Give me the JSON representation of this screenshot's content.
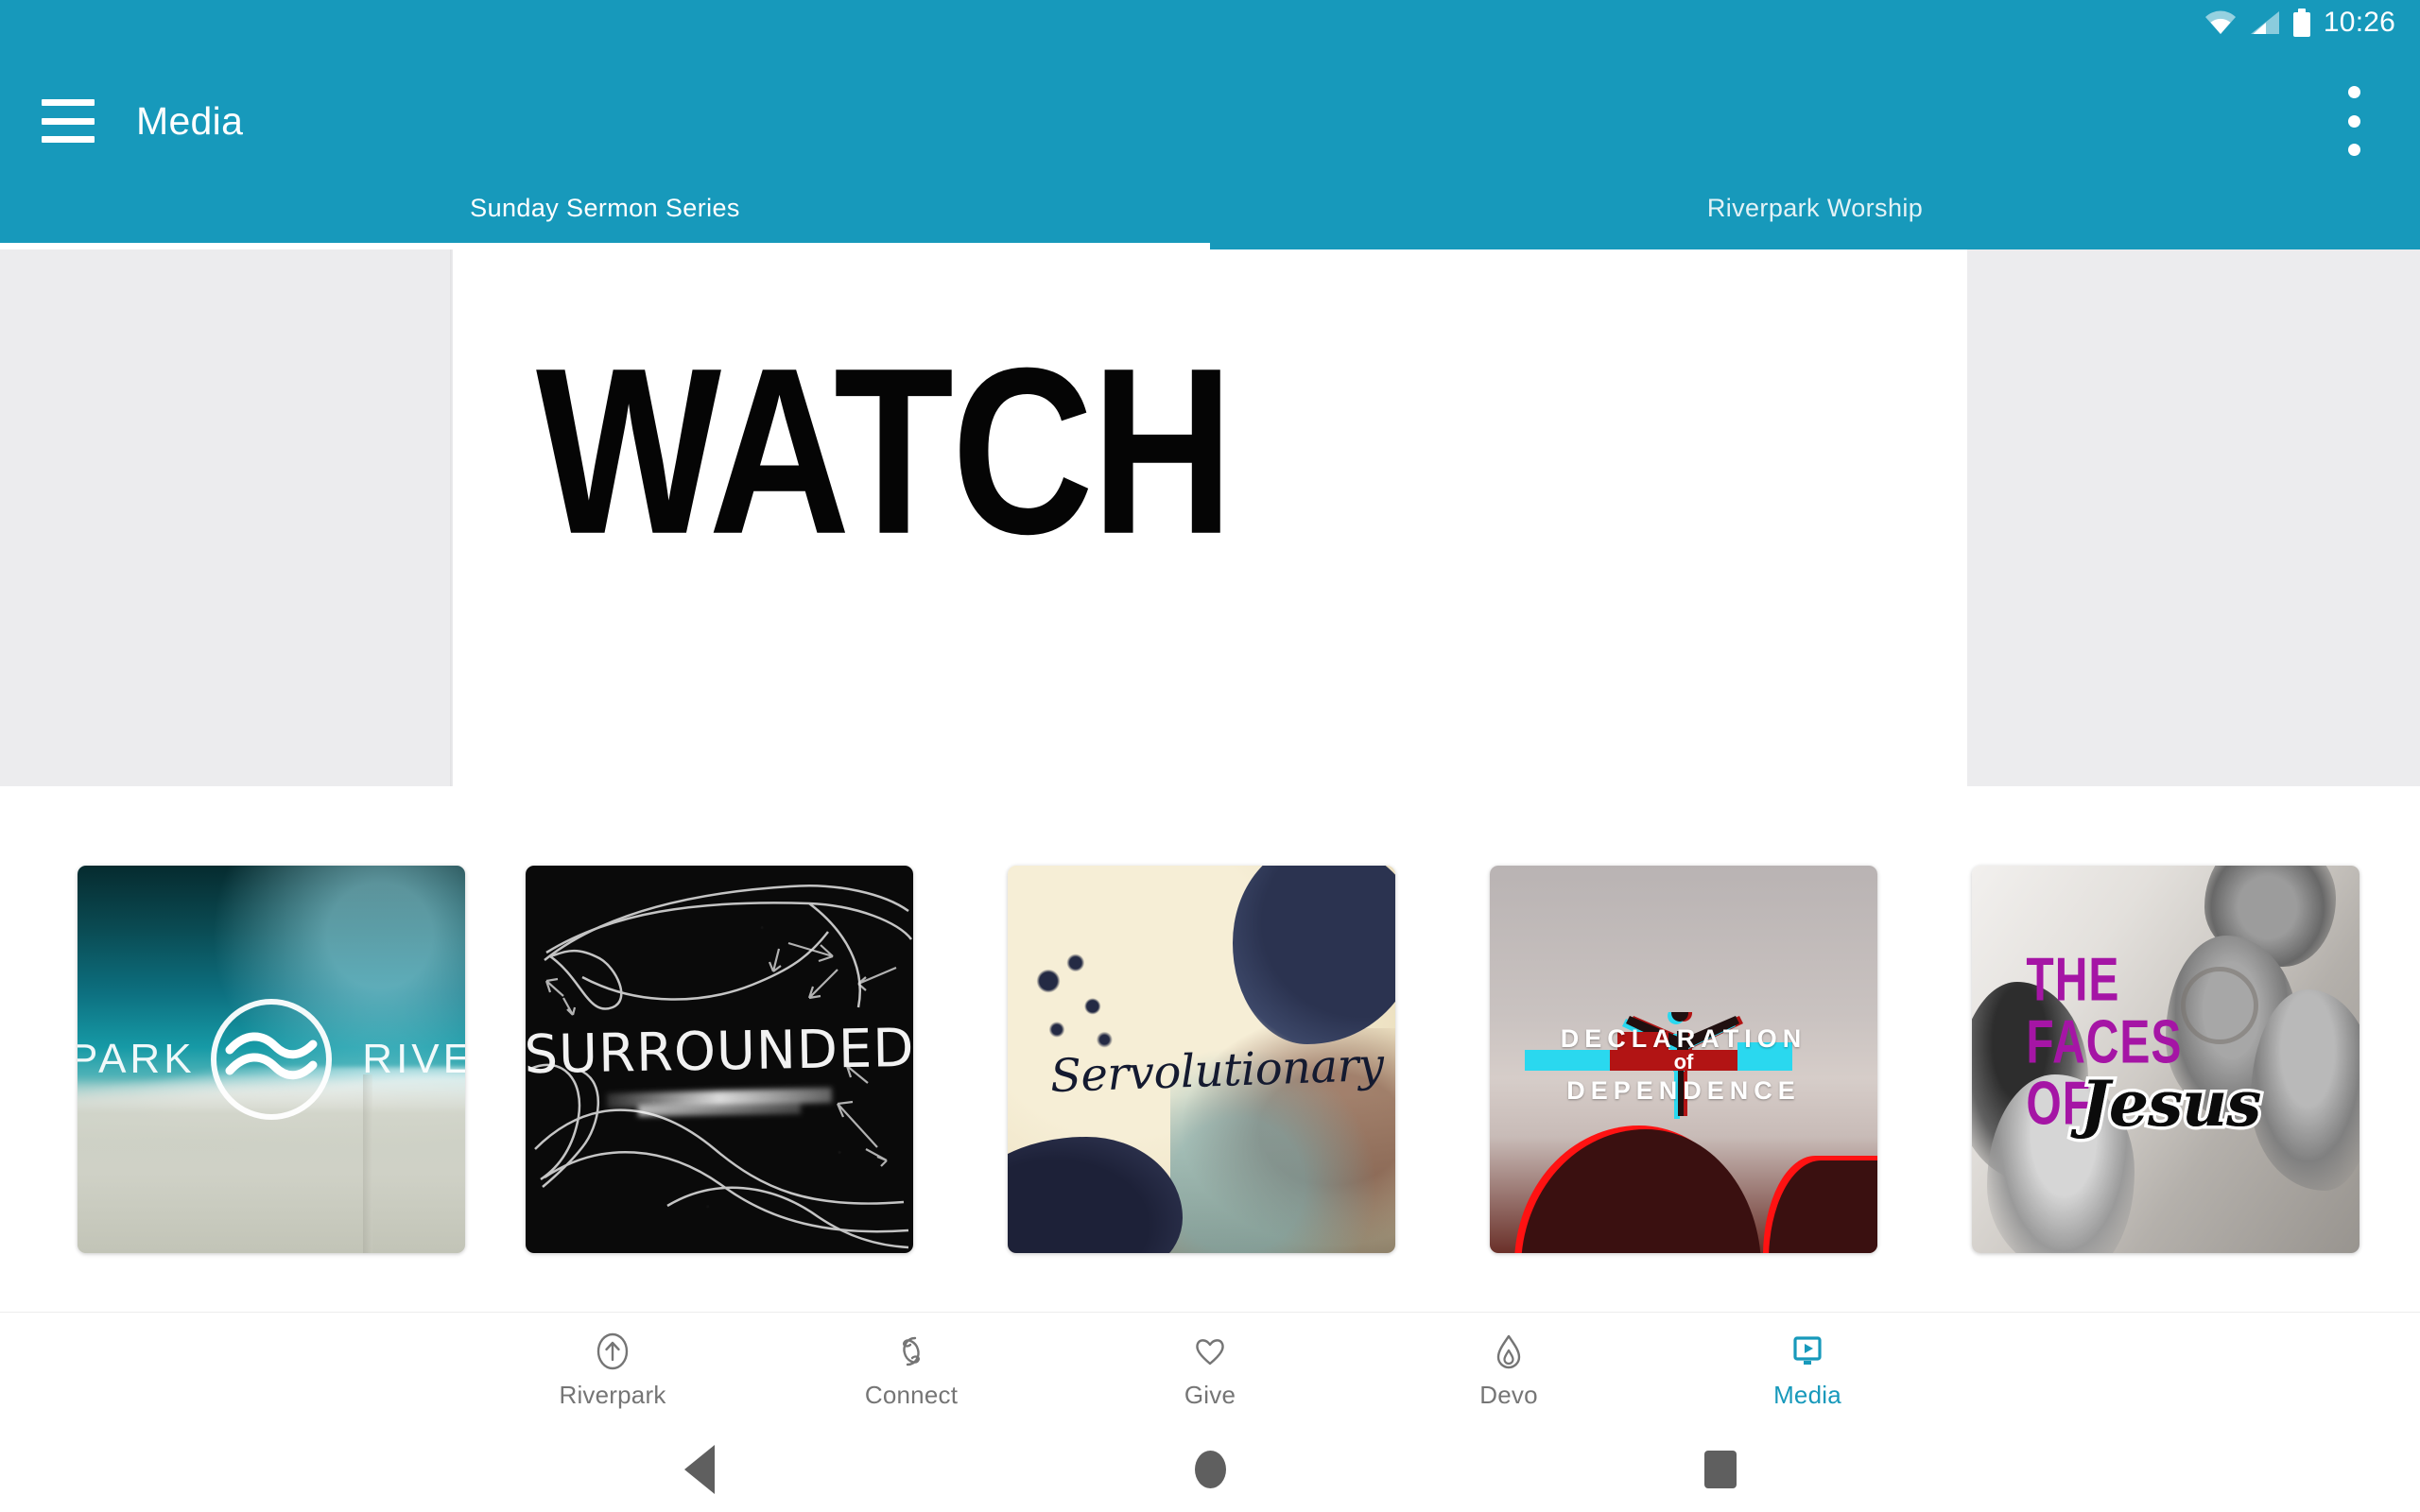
{
  "status_bar": {
    "time": "10:26",
    "icons": [
      "wifi-icon",
      "cell-signal-icon",
      "battery-icon"
    ]
  },
  "app_bar": {
    "menu_icon": "hamburger-menu-icon",
    "title": "Media",
    "overflow_icon": "overflow-menu-icon"
  },
  "tabs": {
    "items": [
      {
        "label": "Sunday Sermon Series",
        "active": true
      },
      {
        "label": "Riverpark Worship",
        "active": false
      }
    ],
    "indicator_color": "#ffffff"
  },
  "hero": {
    "title": "WATCH",
    "card_background": "#ffffff",
    "rail_background": "#ececee"
  },
  "thumbnails": [
    {
      "id": "riverpark-ocean",
      "title": "Riverpark",
      "text_left": "PARK",
      "text_right": "RIVE",
      "logo": "riverpark-wave-logo"
    },
    {
      "id": "surrounded",
      "title": "SURROUNDED"
    },
    {
      "id": "servolutionary",
      "title": "Servolutionary"
    },
    {
      "id": "declaration-of-dependence",
      "line1": "DECLARATION",
      "line2": "of",
      "line3": "DEPENDENCE"
    },
    {
      "id": "the-faces-of-jesus",
      "line1": "THE",
      "line2": "FACES",
      "line3": "OF",
      "line4": "Jesus"
    }
  ],
  "bottom_nav": {
    "items": [
      {
        "label": "Riverpark",
        "icon": "arrow-up-circle-icon",
        "active": false
      },
      {
        "label": "Connect",
        "icon": "link-icon",
        "active": false
      },
      {
        "label": "Give",
        "icon": "heart-icon",
        "active": false
      },
      {
        "label": "Devo",
        "icon": "flame-icon",
        "active": false
      },
      {
        "label": "Media",
        "icon": "monitor-play-icon",
        "active": true
      }
    ],
    "active_color": "#1799bb",
    "inactive_color": "#757575"
  },
  "system_nav": {
    "back": "back-triangle-icon",
    "home": "home-circle-icon",
    "recents": "recents-square-icon"
  },
  "colors": {
    "brand_teal": "#1799bb",
    "hero_rail_gray": "#ececee"
  }
}
